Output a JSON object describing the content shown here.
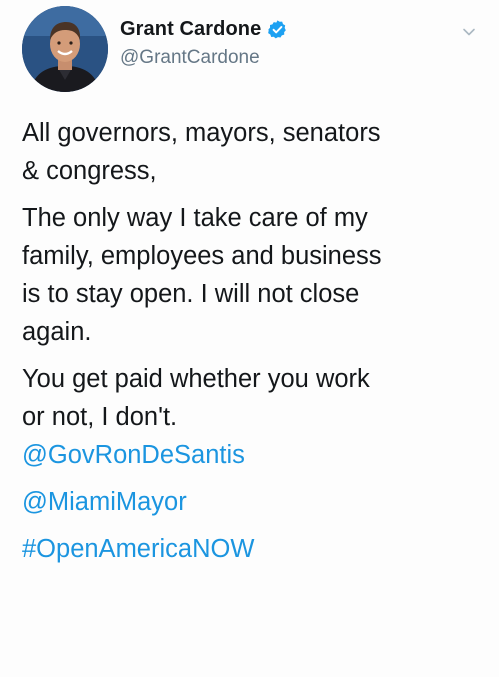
{
  "author": {
    "display_name": "Grant Cardone",
    "handle": "@GrantCardone",
    "verified": true
  },
  "icons": {
    "verified": "verified-badge-icon",
    "menu": "chevron-down-icon"
  },
  "tweet": {
    "paragraphs": [
      {
        "lines": [
          "All governors, mayors, senators",
          "& congress,"
        ]
      },
      {
        "lines": [
          "The only way I take care of my",
          "family, employees and business",
          "is to stay open. I will not close",
          "again."
        ]
      },
      {
        "lines": [
          "You get paid whether you work",
          "or not, I don't."
        ]
      }
    ],
    "mentions": [
      "@GovRonDeSantis",
      "@MiamiMayor"
    ],
    "hashtag": "#OpenAmericaNOW"
  },
  "colors": {
    "text": "#14171a",
    "secondary": "#657786",
    "link": "#1b95e0",
    "verified": "#1da1f2"
  }
}
